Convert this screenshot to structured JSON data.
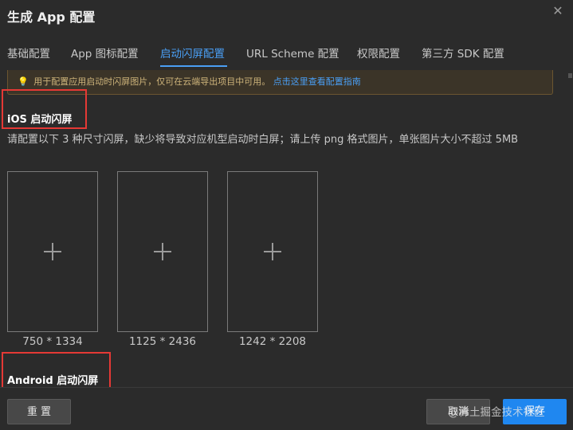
{
  "dialog": {
    "title": "生成 App 配置",
    "close_glyph": "✕"
  },
  "tabs": [
    {
      "label": "基础配置"
    },
    {
      "label": "App 图标配置"
    },
    {
      "label": "启动闪屏配置"
    },
    {
      "label": "URL Scheme 配置"
    },
    {
      "label": "权限配置"
    },
    {
      "label": "第三方 SDK 配置"
    }
  ],
  "notice": {
    "icon": "💡",
    "text": "用于配置应用启动时闪屏图片，仅可在云端导出项目中可用。",
    "link": "点击这里查看配置指南"
  },
  "ios": {
    "title": "iOS 启动闪屏",
    "description": "请配置以下 3 种尺寸闪屏，缺少将导致对应机型启动时白屏；请上传 png 格式图片，单张图片大小不超过 5MB",
    "sizes": [
      "750 * 1334",
      "1125 * 2436",
      "1242 * 2208"
    ]
  },
  "android": {
    "title": "Android 启动闪屏"
  },
  "footer": {
    "reset_label": "重 置",
    "cancel_label": "取消",
    "save_label": "保存",
    "watermark": "@稀土掘金技术社区"
  },
  "colors": {
    "background": "#2b2b2b",
    "accent": "#4a9ff5",
    "primary_button": "#1f87f0",
    "highlight_box": "#e53935",
    "notice_bg": "#3b3428"
  }
}
